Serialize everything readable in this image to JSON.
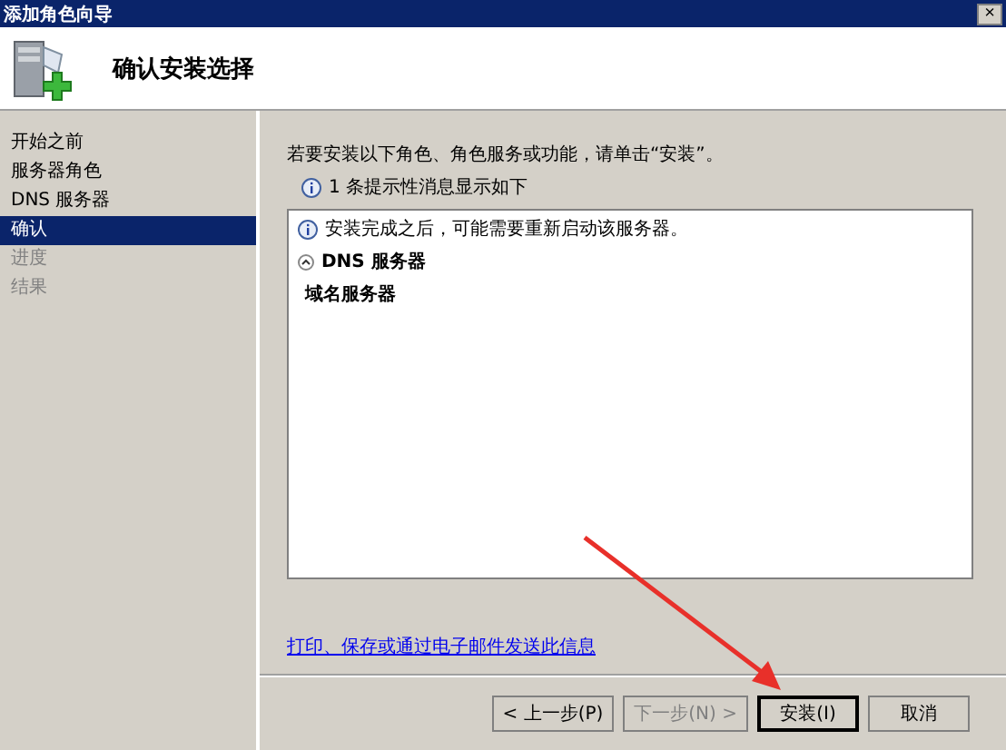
{
  "window": {
    "title": "添加角色向导",
    "close": "×"
  },
  "header": {
    "title": "确认安装选择"
  },
  "sidebar": {
    "items": [
      {
        "label": "开始之前",
        "selected": false,
        "disabled": false
      },
      {
        "label": "服务器角色",
        "selected": false,
        "disabled": false
      },
      {
        "label": "DNS 服务器",
        "selected": false,
        "disabled": false
      },
      {
        "label": "确认",
        "selected": true,
        "disabled": false
      },
      {
        "label": "进度",
        "selected": false,
        "disabled": true
      },
      {
        "label": "结果",
        "selected": false,
        "disabled": true
      }
    ]
  },
  "content": {
    "intro": "若要安装以下角色、角色服务或功能，请单击“安装”。",
    "notice": "1 条提示性消息显示如下",
    "list": {
      "message": "安装完成之后，可能需要重新启动该服务器。",
      "groups": [
        {
          "title": "DNS 服务器",
          "expanded": true,
          "items": [
            "域名服务器"
          ]
        }
      ]
    },
    "link": "打印、保存或通过电子邮件发送此信息"
  },
  "buttons": [
    {
      "label": "< 上一步(P)",
      "disabled": false,
      "default": false
    },
    {
      "label": "下一步(N) >",
      "disabled": true,
      "default": false
    },
    {
      "label": "安装(I)",
      "disabled": false,
      "default": true
    },
    {
      "label": "取消",
      "disabled": false,
      "default": false
    }
  ]
}
